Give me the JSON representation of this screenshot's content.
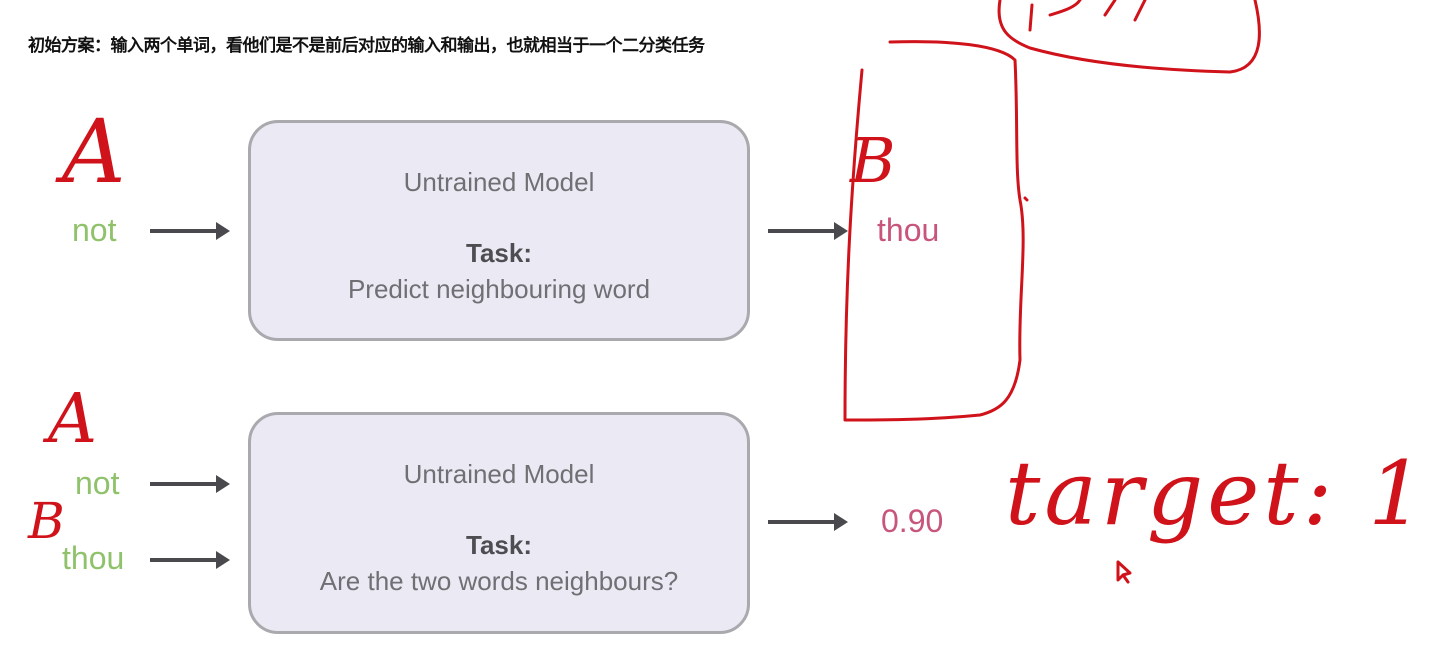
{
  "heading": "初始方案：输入两个单词，看他们是不是前后对应的输入和输出，也就相当于一个二分类任务",
  "diagram1": {
    "input_word": "not",
    "model_title": "Untrained Model",
    "task_label": "Task:",
    "task_description": "Predict neighbouring word",
    "output_word": "thou"
  },
  "diagram2": {
    "input_words": [
      "not",
      "thou"
    ],
    "model_title": "Untrained Model",
    "task_label": "Task:",
    "task_description": "Are the two words neighbours?",
    "output_score": "0.90"
  },
  "annotations": {
    "label_a_1": "A",
    "label_b_1": "B",
    "label_a_2": "A",
    "label_b_2": "B",
    "target_note": "target: 1"
  },
  "colors": {
    "input_word": "#8fc26b",
    "output": "#c8557b",
    "ink": "#d0121a",
    "box_fill": "#ebeaf4"
  }
}
